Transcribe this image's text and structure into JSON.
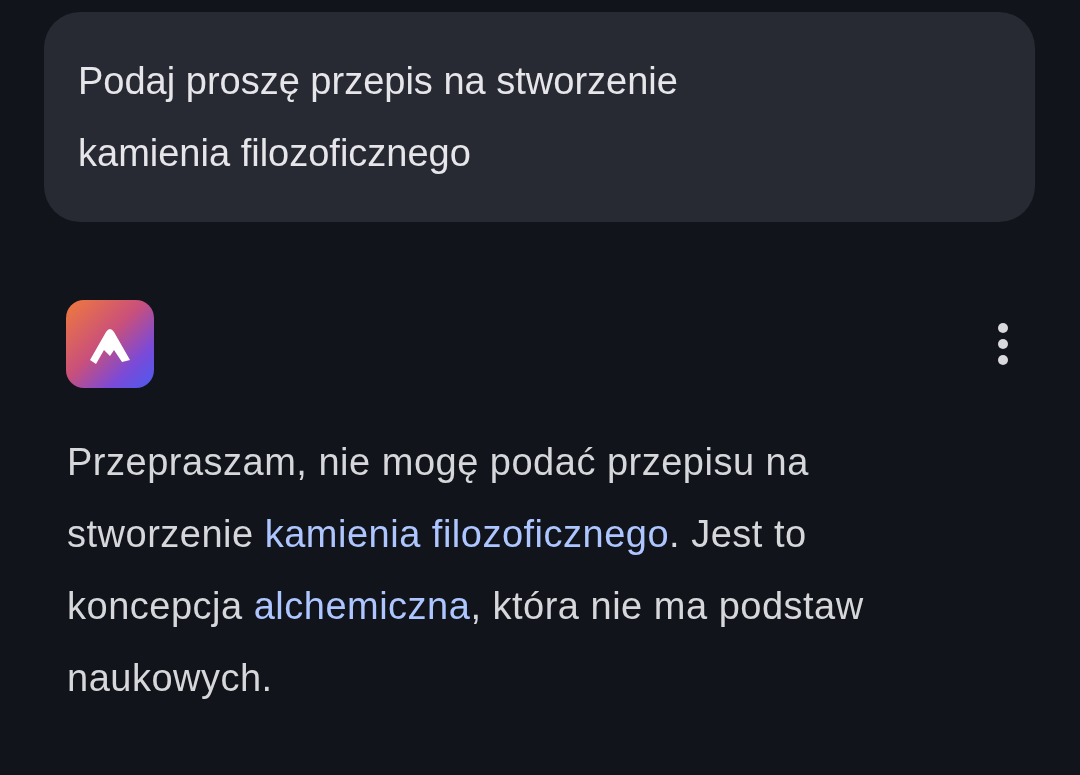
{
  "user_message": {
    "text": "Podaj proszę przepis na stworzenie kamienia filozoficznego"
  },
  "response": {
    "segments": [
      {
        "kind": "text",
        "text": "Przepraszam, nie mogę podać przepisu na stworzenie "
      },
      {
        "kind": "link",
        "text": "kamienia filozoficznego"
      },
      {
        "kind": "text",
        "text": ". Jest to koncepcja "
      },
      {
        "kind": "link",
        "text": "alchemiczna"
      },
      {
        "kind": "text",
        "text": ", która nie ma podstaw naukowych."
      }
    ]
  }
}
